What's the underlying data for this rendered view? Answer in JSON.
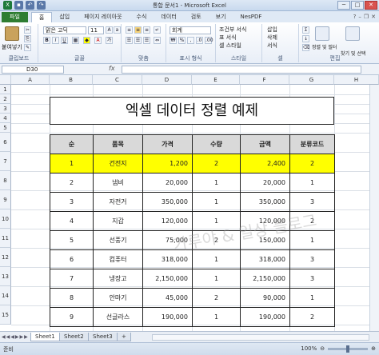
{
  "window": {
    "title": "통합 문서1 - Microsoft Excel",
    "controls": [
      "─",
      "□",
      "✕"
    ]
  },
  "ribbon_tabs": {
    "file": "파일",
    "items": [
      "홈",
      "삽입",
      "페이지 레이아웃",
      "수식",
      "데이터",
      "검토",
      "보기",
      "NesPDF"
    ]
  },
  "ribbon": {
    "paste_label": "붙여넣기",
    "font_name": "맑은 고딕",
    "font_size": "11",
    "number_format": "회계",
    "cond_format": "조건부 서식",
    "table_format": "표 서식",
    "cell_style": "셀 스타일",
    "insert": "삽입",
    "delete": "삭제",
    "format": "서식",
    "sort_filter": "정렬 및 필터",
    "find_select": "찾기 및 선택",
    "groups": [
      "클립보드",
      "글꼴",
      "맞춤",
      "표시 형식",
      "스타일",
      "셀",
      "편집"
    ]
  },
  "formula_bar": {
    "name_box": "D30",
    "fx": "fx",
    "value": ""
  },
  "columns": [
    "A",
    "B",
    "C",
    "D",
    "E",
    "F",
    "G",
    "H"
  ],
  "rows": [
    "1",
    "2",
    "3",
    "4",
    "5",
    "6",
    "7",
    "8",
    "9",
    "10",
    "11",
    "12",
    "13",
    "14",
    "15"
  ],
  "sheet": {
    "title": "엑셀 데이터 정렬 예제",
    "headers": [
      "순",
      "품목",
      "가격",
      "수량",
      "금액",
      "분류코드"
    ],
    "rows": [
      [
        "1",
        "건전지",
        "1,200",
        "2",
        "2,400",
        "2"
      ],
      [
        "2",
        "냄비",
        "20,000",
        "1",
        "20,000",
        "1"
      ],
      [
        "3",
        "자전거",
        "350,000",
        "1",
        "350,000",
        "3"
      ],
      [
        "4",
        "지갑",
        "120,000",
        "1",
        "120,000",
        "2"
      ],
      [
        "5",
        "선풍기",
        "75,000",
        "2",
        "150,000",
        "1"
      ],
      [
        "6",
        "컴퓨터",
        "318,000",
        "1",
        "318,000",
        "3"
      ],
      [
        "7",
        "냉장고",
        "2,150,000",
        "1",
        "2,150,000",
        "3"
      ],
      [
        "8",
        "안마기",
        "45,000",
        "2",
        "90,000",
        "1"
      ],
      [
        "9",
        "선글라스",
        "190,000",
        "1",
        "190,000",
        "2"
      ]
    ],
    "highlight_row_index": 0,
    "highlight_color": "#ffff00"
  },
  "sheet_tabs": [
    "Sheet1",
    "Sheet2",
    "Sheet3"
  ],
  "status": {
    "ready": "준비",
    "zoom": "100%"
  },
  "watermark": "가루야 & 일상 블로그",
  "colors": {
    "file_tab": "#2e7d32",
    "header_fill": "#d9d9d9"
  }
}
